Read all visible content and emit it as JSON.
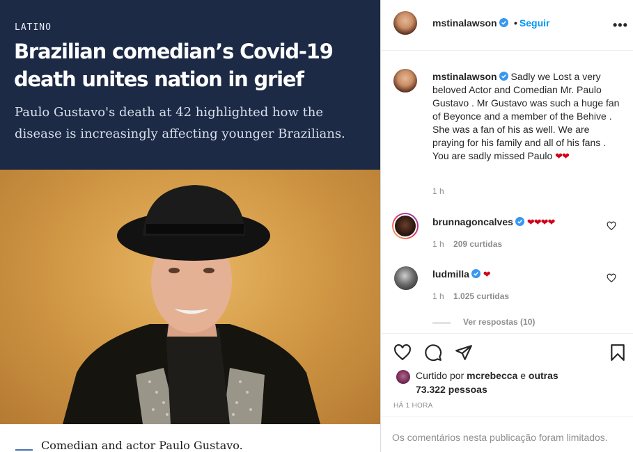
{
  "article": {
    "kicker": "LATINO",
    "headline": "Brazilian comedian’s Covid-19 death unites nation in grief",
    "deck": "Paulo Gustavo's death at 42 highlighted how the disease is increasingly affecting younger Brazilians.",
    "caption": "Comedian and actor Paulo Gustavo."
  },
  "post": {
    "author": "mstinalawson",
    "follow_dot": "•",
    "follow_label": "Seguir",
    "more_label": "•••",
    "caption_author": "mstinalawson",
    "caption_text": " Sadly we Lost a very beloved Actor and Comedian Mr. Paulo Gustavo . Mr Gustavo was such a huge fan of Beyonce and a member of the Behive . She was a fan of his as well. We are praying for his family and all of his fans . You are sadly missed Paulo ",
    "caption_hearts": "❤❤",
    "caption_time": "1 h",
    "comments": [
      {
        "user": "brunnagoncalves",
        "text": "❤❤❤❤",
        "time": "1 h",
        "likes": "209 curtidas"
      },
      {
        "user": "ludmilla",
        "text": "❤",
        "time": "1 h",
        "likes": "1.025 curtidas"
      }
    ],
    "view_replies": "Ver respostas (10)",
    "liked_prefix": "Curtido por ",
    "liked_user": "mcrebecca",
    "liked_mid": " e ",
    "liked_others": "outras 73.322 pessoas",
    "timestamp": "HÁ 1 HORA",
    "comments_limited": "Os comentários nesta publicação foram limitados."
  },
  "icons": [
    "verified-icon",
    "more-icon",
    "heart-icon",
    "comment-icon",
    "share-icon",
    "bookmark-icon"
  ],
  "colors": {
    "link": "#0095f6",
    "navy": "#1c2a46",
    "heart": "#d0021b",
    "muted": "#8e8e8e"
  }
}
